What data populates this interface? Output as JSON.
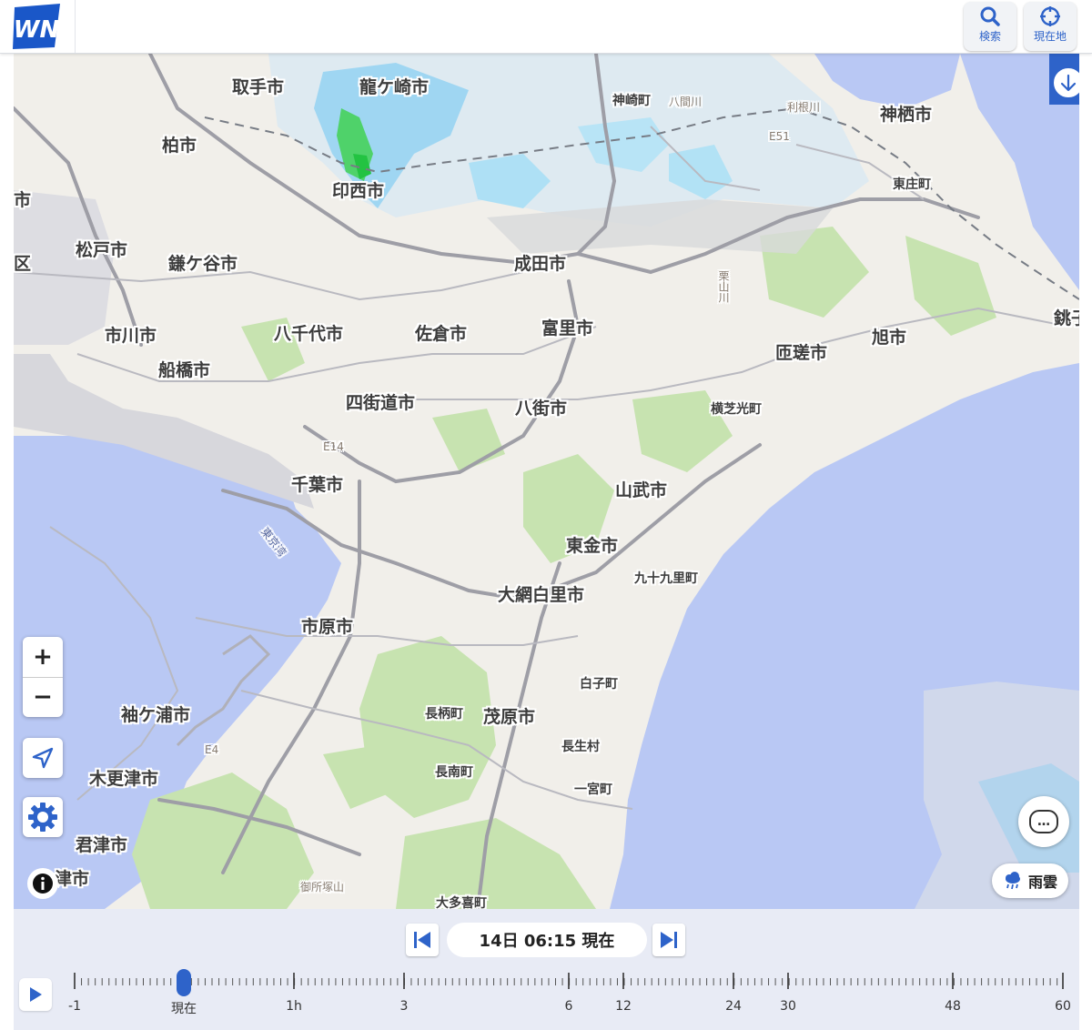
{
  "header": {
    "logo_text": "WN",
    "search_label": "検索",
    "location_label": "現在地"
  },
  "map": {
    "labels": {
      "toride": "取手市",
      "ryugasaki": "龍ケ崎市",
      "kozaki": "神崎町",
      "yamagawa": "八間川",
      "tone": "利根川",
      "kamisu": "神栖市",
      "kashiwa": "柏市",
      "inzai": "印西市",
      "higashisho": "東庄町",
      "shi_edge": "市",
      "matsudo": "松戸市",
      "kamagaya": "鎌ケ谷市",
      "narita": "成田市",
      "kuri": "栗山川",
      "ku_edge": "区",
      "choshi": "銚子",
      "ichikawa": "市川市",
      "yachiyo": "八千代市",
      "sakura": "佐倉市",
      "tomisato": "富里市",
      "sosa": "匝瑳市",
      "asahi": "旭市",
      "funabashi": "船橋市",
      "yotsukaido": "四街道市",
      "yachimata": "八街市",
      "yokoshibahikari": "横芝光町",
      "chiba": "千葉市",
      "sanmu": "山武市",
      "tokyowan": "東京湾",
      "togane": "東金市",
      "kujukuri": "九十九里町",
      "oamishirasato": "大網白里市",
      "ichihara": "市原市",
      "shirako": "白子町",
      "sodegaura": "袖ケ浦市",
      "nagara": "長柄町",
      "mobara": "茂原市",
      "chosei": "長生村",
      "kisarazu": "木更津市",
      "chonan": "長南町",
      "ichinomiya": "一宮町",
      "kimitsu": "君津市",
      "gosho": "御所塚山",
      "otaki": "大多喜町",
      "futtsu": "津市",
      "e4": "E4",
      "e14": "E14",
      "e51": "E51"
    }
  },
  "controls": {
    "zoom_in": "+",
    "zoom_out": "−",
    "layer_label": "雨雲",
    "chat_icon": "…"
  },
  "timeline": {
    "current_time": "14日 06:15 現在",
    "ticks": [
      "-1",
      "現在",
      "1h",
      "3",
      "6",
      "12",
      "24",
      "30",
      "48",
      "60"
    ],
    "position": "現在"
  }
}
